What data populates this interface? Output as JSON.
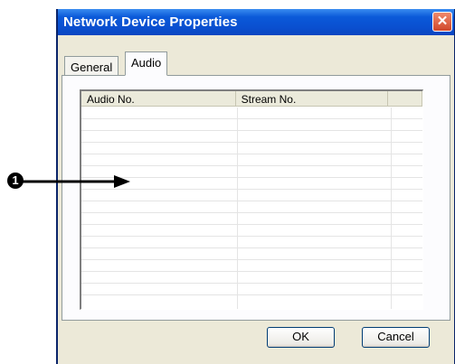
{
  "window": {
    "title": "Network Device Properties",
    "close_glyph": "✕"
  },
  "tabs": [
    {
      "label": "General"
    },
    {
      "label": "Audio"
    }
  ],
  "table": {
    "columns": [
      "Audio No.",
      "Stream No.",
      ""
    ],
    "rows": [
      [
        "",
        "",
        ""
      ],
      [
        "",
        "",
        ""
      ],
      [
        "",
        "",
        ""
      ],
      [
        "",
        "",
        ""
      ],
      [
        "",
        "",
        ""
      ],
      [
        "",
        "",
        ""
      ],
      [
        "",
        "",
        ""
      ],
      [
        "",
        "",
        ""
      ],
      [
        "",
        "",
        ""
      ],
      [
        "",
        "",
        ""
      ],
      [
        "",
        "",
        ""
      ],
      [
        "",
        "",
        ""
      ],
      [
        "",
        "",
        ""
      ],
      [
        "",
        "",
        ""
      ],
      [
        "",
        "",
        ""
      ],
      [
        "",
        "",
        ""
      ]
    ]
  },
  "buttons": {
    "ok": "OK",
    "cancel": "Cancel"
  },
  "callout": {
    "number": "1"
  },
  "colors": {
    "titlebar": "#0a4fd0",
    "close": "#d0462a",
    "dialog_bg": "#ece9d8"
  },
  "icons": {
    "close": "close-icon",
    "callout_arrow": "arrow-right-icon"
  }
}
